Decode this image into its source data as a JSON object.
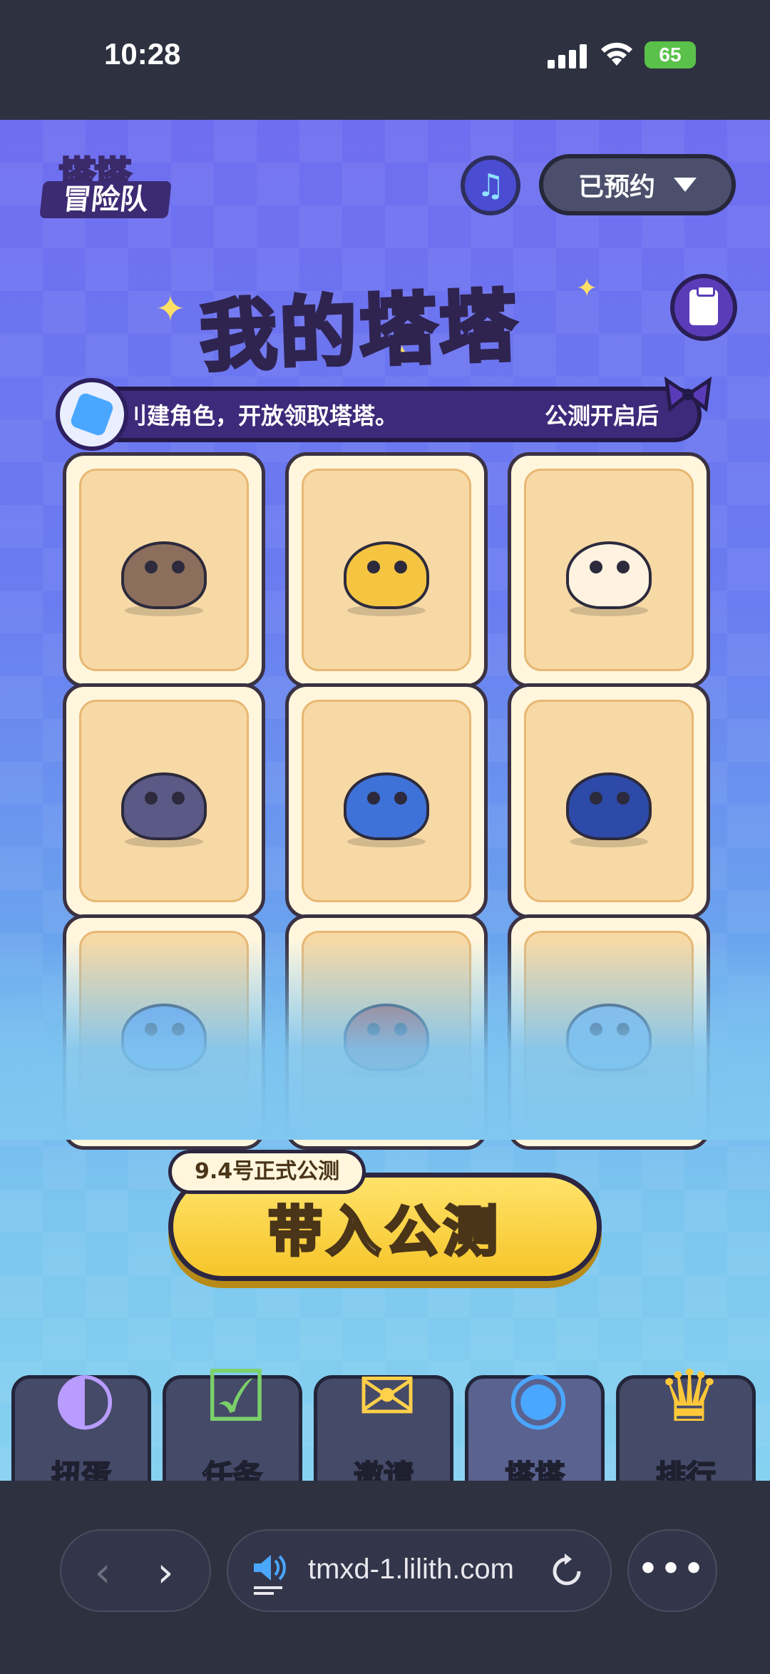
{
  "status_bar": {
    "time": "10:28",
    "battery": "65"
  },
  "header": {
    "logo_line1": "塔塔",
    "logo_line2": "冒险队",
    "reserve_label": "已预约"
  },
  "title": {
    "part1": "我的",
    "part2": "塔塔"
  },
  "banner": {
    "text": "创建角色，开放领取塔塔。",
    "text_visible": "刂建角色，开放领取塔塔。",
    "text2": "公测开启后"
  },
  "pets": [
    {
      "name": "monkey",
      "color": "#8b6f5c"
    },
    {
      "name": "fox-dog",
      "color": "#f5c542"
    },
    {
      "name": "chicken-ghost",
      "color": "#fff2e0"
    },
    {
      "name": "boar",
      "color": "#5b5a86"
    },
    {
      "name": "crab",
      "color": "#3f72d8"
    },
    {
      "name": "toucan",
      "color": "#2e4aa8"
    },
    {
      "name": "chameleon",
      "color": "#6e9be8"
    },
    {
      "name": "pot-pig",
      "color": "#c0564a"
    },
    {
      "name": "star-slime",
      "color": "#8fb5e8"
    }
  ],
  "cta": {
    "tag": "9.4号正式公测",
    "label": "带入公测"
  },
  "bottom_nav": [
    {
      "label": "扭蛋",
      "icon": "capsule-icon"
    },
    {
      "label": "任务",
      "icon": "clipboard-icon"
    },
    {
      "label": "邀请",
      "icon": "envelope-icon"
    },
    {
      "label": "塔塔",
      "icon": "pet-icon"
    },
    {
      "label": "排行",
      "icon": "trophy-icon"
    }
  ],
  "browser": {
    "url": "tmxd-1.lilith.com"
  }
}
